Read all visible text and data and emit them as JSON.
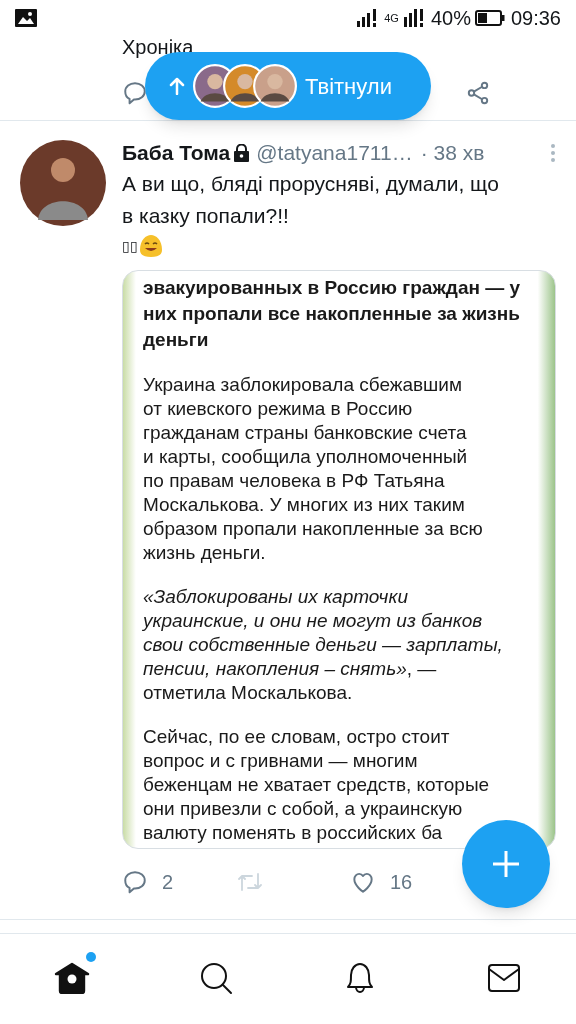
{
  "status_bar": {
    "network": "4G",
    "battery": "40%",
    "time": "09:36"
  },
  "previous_tweet": {
    "text": "Хроніка"
  },
  "new_tweets_pill": {
    "label": "Твітнули"
  },
  "tweet": {
    "name": "Баба Тома",
    "protected": true,
    "handle": "@tatyana1711…",
    "time": "· 38 хв",
    "text_lines": [
      "А ви що, бляді прорусняві, думали, що",
      "в казку попали?!!"
    ],
    "emoji_text": "▯▯",
    "image": {
      "paragraphs": [
        {
          "kind": "heading",
          "lines": [
            "эвакуированных в Россию граждан — у",
            "них пропали все накопленные за жизнь",
            "деньги"
          ]
        },
        {
          "kind": "body",
          "lines": [
            "Украина заблокировала сбежавшим",
            "от киевского режима в Россию",
            "гражданам страны банковские счета",
            "и карты, сообщила уполномоченный",
            "по правам человека в РФ Татьяна",
            "Москалькова. У многих из них таким",
            "образом пропали накопленные за всю",
            "жизнь деньги."
          ]
        },
        {
          "kind": "body",
          "lines": [
            "*«Заблокированы их карточки*",
            "*украинские, и они не могут из банков*",
            "*свои собственные деньги — зарплаты,*",
            "*пенсии, накопления – снять»*, —",
            "отметила Москалькова."
          ]
        },
        {
          "kind": "body",
          "lines": [
            "Сейчас, по ее словам, остро стоит",
            "вопрос и с гривнами — многим",
            "беженцам не хватает средств, которые",
            "они привезли с собой, а украинскую",
            "валюту поменять в российских ба"
          ]
        }
      ]
    },
    "actions": [
      {
        "kind": "reply",
        "count": "2",
        "disabled": false
      },
      {
        "kind": "retweet",
        "disabled": true
      },
      {
        "kind": "like",
        "count": "16",
        "disabled": false
      }
    ]
  },
  "bottom_nav": [
    {
      "kind": "home",
      "selected": true,
      "badge": true
    },
    {
      "kind": "search",
      "selected": false,
      "badge": false
    },
    {
      "kind": "notifications",
      "selected": false,
      "badge": false
    },
    {
      "kind": "messages",
      "selected": false,
      "badge": false
    }
  ]
}
